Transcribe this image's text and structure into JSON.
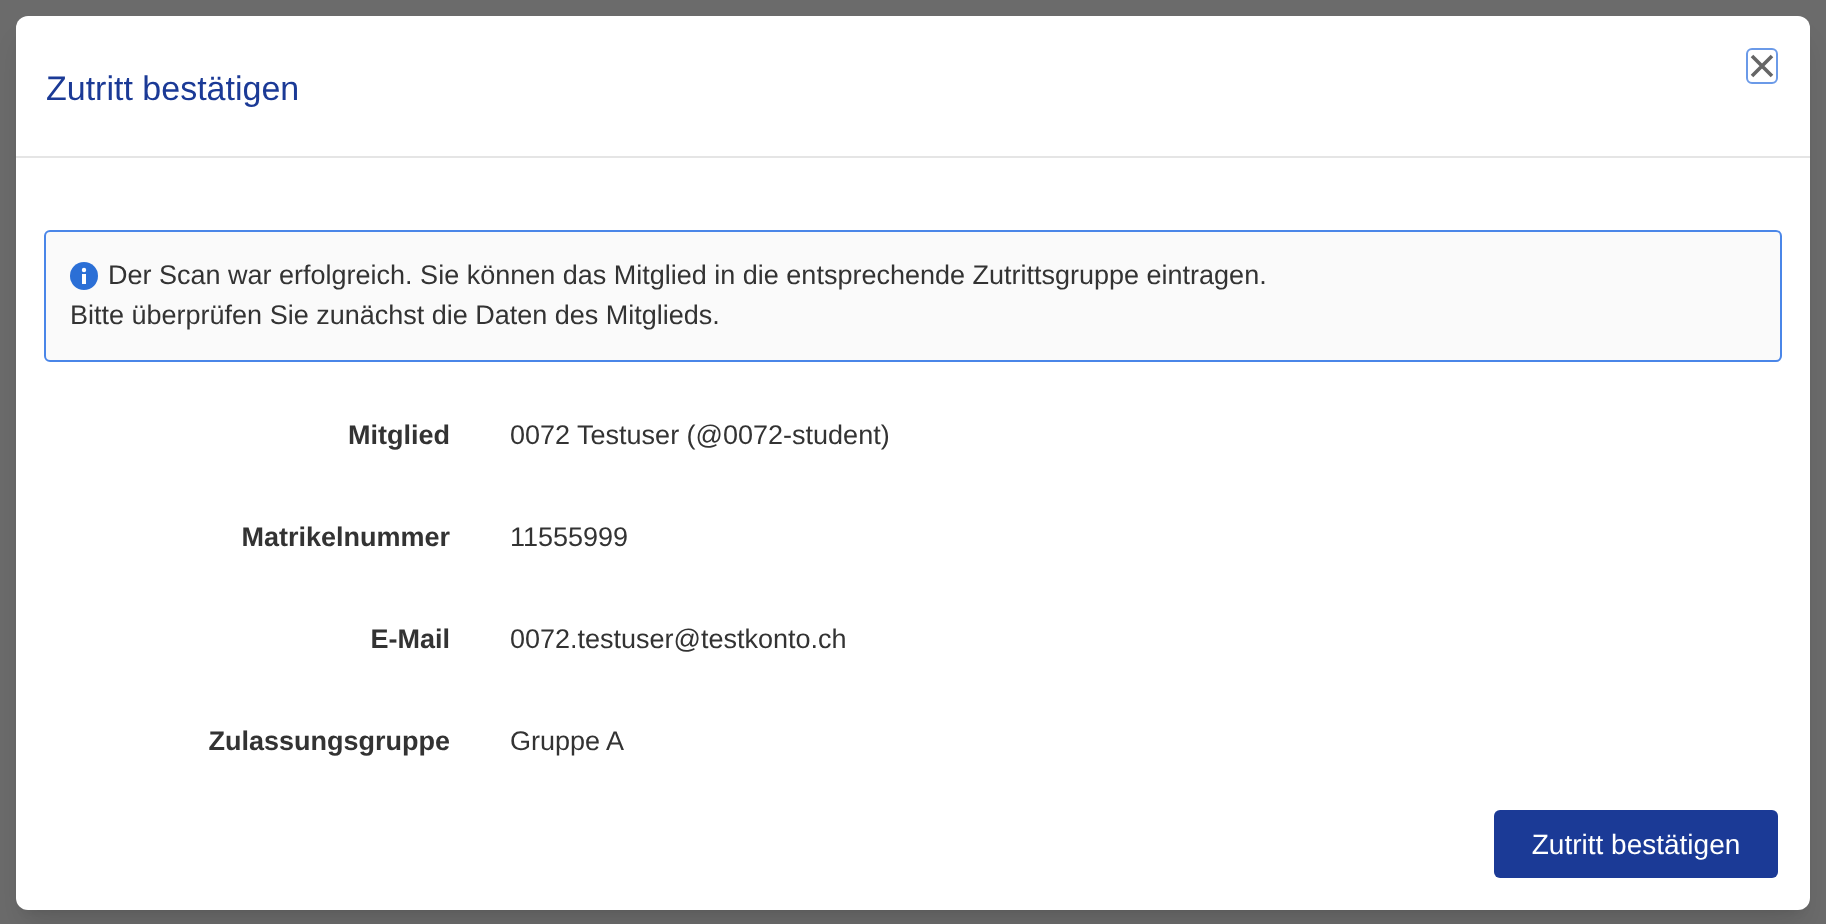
{
  "dialog": {
    "title": "Zutritt bestätigen",
    "alert": {
      "lines": [
        "Der Scan war erfolgreich. Sie können das Mitglied in die entsprechende Zutrittsgruppe eintragen.",
        "Bitte überprüfen Sie zunächst die Daten des Mitglieds."
      ]
    },
    "fields": [
      {
        "label": "Mitglied",
        "value": "0072 Testuser (@0072-student)"
      },
      {
        "label": "Matrikelnummer",
        "value": "11555999"
      },
      {
        "label": "E-Mail",
        "value": "0072.testuser@testkonto.ch"
      },
      {
        "label": "Zulassungsgruppe",
        "value": "Gruppe A"
      }
    ],
    "confirm_button": "Zutritt bestätigen"
  }
}
